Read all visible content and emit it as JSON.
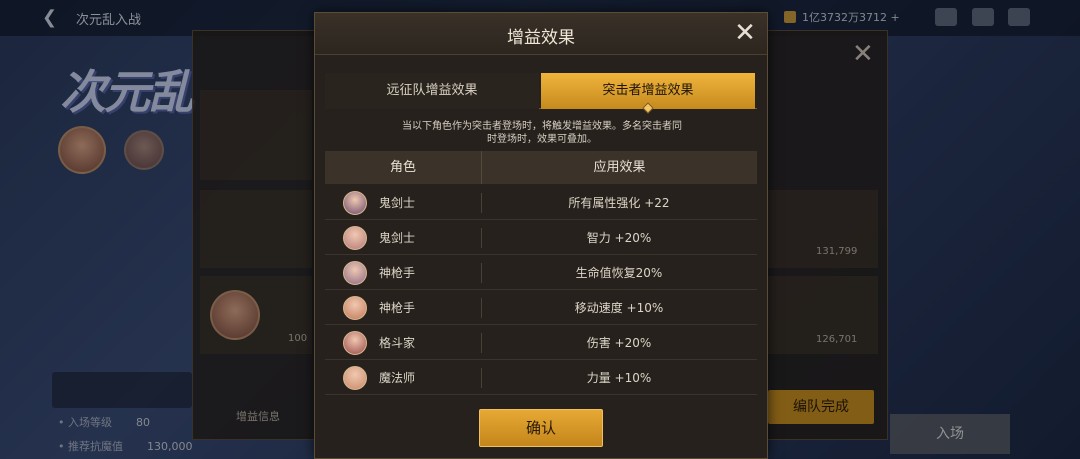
{
  "background": {
    "back_arrow": "back-arrow-icon",
    "screen_title": "次元乱入战",
    "currency_value": "1亿3732万3712",
    "currency_plus": "+",
    "logo_text": "次元乱",
    "panel": {
      "left_stat_labels": [
        "• 入场等级",
        "• 推荐抗魔值"
      ],
      "left_stat_values": [
        "80",
        "130,000"
      ],
      "row_values": [
        "131,799",
        "126,701"
      ],
      "row_level": "100",
      "buff_info_label": "增益信息",
      "team_complete_button": "编队完成",
      "enter_button": "入场"
    }
  },
  "modal": {
    "title": "增益效果",
    "close_icon": "close-icon",
    "tabs": [
      {
        "label": "远征队增益效果",
        "active": false
      },
      {
        "label": "突击者增益效果",
        "active": true
      }
    ],
    "description": "当以下角色作为突击者登场时，将触发增益效果。多名突击者同时登场时，效果可叠加。",
    "table": {
      "headers": {
        "role": "角色",
        "effect": "应用效果"
      },
      "rows": [
        {
          "role": "鬼剑士",
          "effect": "所有属性强化 +22",
          "avatar_color": "#6b4a6e"
        },
        {
          "role": "鬼剑士",
          "effect": "智力 +20%",
          "avatar_color": "#b57a7a"
        },
        {
          "role": "神枪手",
          "effect": "生命值恢复20%",
          "avatar_color": "#8c6a88"
        },
        {
          "role": "神枪手",
          "effect": "移动速度 +10%",
          "avatar_color": "#c27a5a"
        },
        {
          "role": "格斗家",
          "effect": "伤害 +20%",
          "avatar_color": "#9a4a4a"
        },
        {
          "role": "魔法师",
          "effect": "力量 +10%",
          "avatar_color": "#c98a6a"
        }
      ]
    },
    "confirm_label": "确认"
  },
  "colors": {
    "accent_gold": "#e0a030",
    "modal_bg": "#26211c",
    "header_bg": "#3b3229"
  }
}
